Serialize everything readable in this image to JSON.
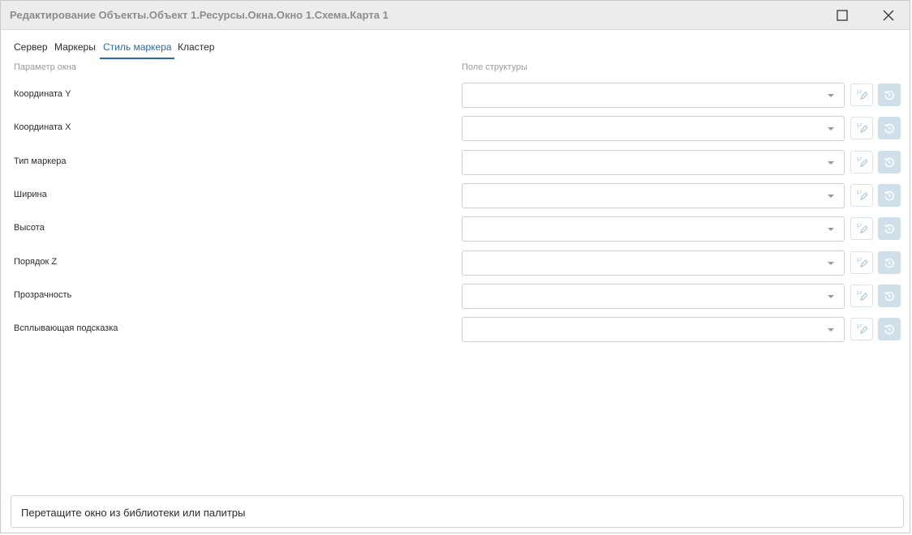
{
  "window": {
    "title": "Редактирование Объекты.Объект 1.Ресурсы.Окна.Окно 1.Схема.Карта 1",
    "icons": {
      "maximize": "maximize-icon",
      "close": "close-icon"
    }
  },
  "tabs": [
    {
      "label": "Сервер",
      "active": false
    },
    {
      "label": "Маркеры",
      "active": false
    },
    {
      "label": "Стиль маркера",
      "active": true
    },
    {
      "label": "Кластер",
      "active": false
    }
  ],
  "columns": {
    "param": "Параметр окна",
    "field": "Поле структуры"
  },
  "rows": [
    {
      "label": "Координата Y",
      "value": ""
    },
    {
      "label": "Координата X",
      "value": ""
    },
    {
      "label": "Тип маркера",
      "value": ""
    },
    {
      "label": "Ширина",
      "value": ""
    },
    {
      "label": "Высота",
      "value": ""
    },
    {
      "label": "Порядок Z",
      "value": ""
    },
    {
      "label": "Прозрачность",
      "value": ""
    },
    {
      "label": "Всплывающая подсказка",
      "value": ""
    }
  ],
  "row_icons": {
    "edit": "edit-mapping-icon",
    "reset": "reset-icon",
    "dropdown": "chevron-down-icon"
  },
  "colors": {
    "accent": "#2d6aa0",
    "reset_bg": "#cfe0ea",
    "icon": "#a9c7d6"
  },
  "dropzone": {
    "text": "Перетащите окно из библиотеки или палитры"
  }
}
